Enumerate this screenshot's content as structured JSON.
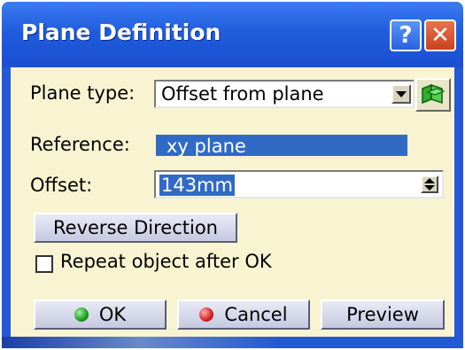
{
  "window": {
    "title": "Plane Definition",
    "help_label": "?",
    "close_label": "✕"
  },
  "plane_type": {
    "label": "Plane type:",
    "value": "Offset from plane"
  },
  "reference": {
    "label": "Reference:",
    "value": "xy plane"
  },
  "offset": {
    "label": "Offset:",
    "value": "143mm"
  },
  "reverse_label": "Reverse Direction",
  "repeat": {
    "label": "Repeat object after OK",
    "checked": false
  },
  "buttons": {
    "ok": "OK",
    "cancel": "Cancel",
    "preview": "Preview"
  },
  "colors": {
    "titlebar": "#1f5ddd",
    "client_bg": "#f8f4d2",
    "selection": "#316ac5"
  }
}
